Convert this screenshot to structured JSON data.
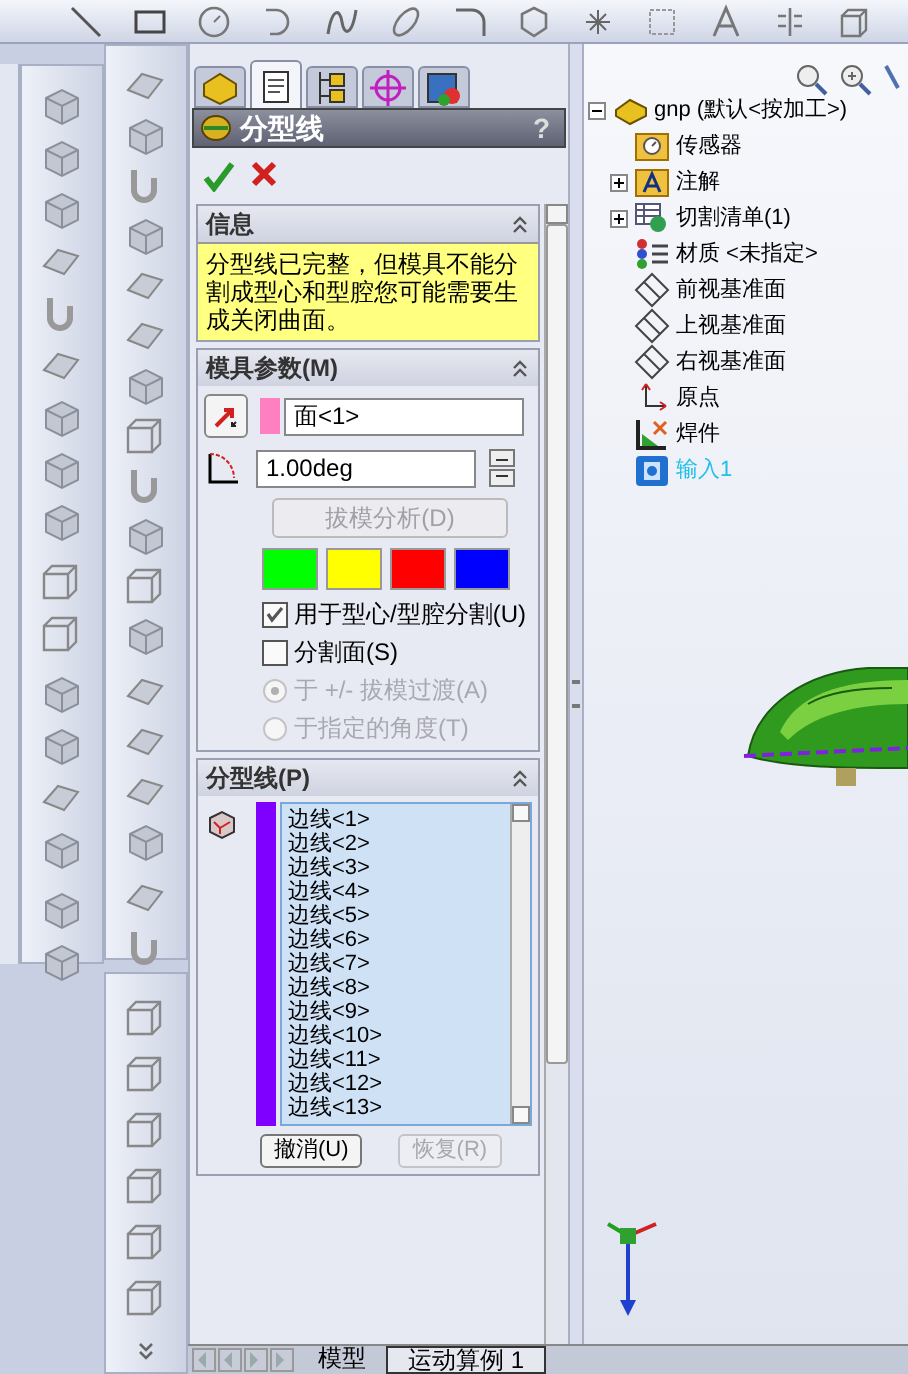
{
  "property_manager": {
    "tabs": [
      {
        "kind": "feature",
        "selected": false
      },
      {
        "kind": "property",
        "selected": true
      },
      {
        "kind": "config",
        "selected": false
      },
      {
        "kind": "target",
        "selected": false
      },
      {
        "kind": "display",
        "selected": false
      }
    ],
    "title": "分型线",
    "help": "?",
    "info": {
      "title": "信息",
      "message": "分型线已完整，但模具不能分割成型心和型腔您可能需要生成关闭曲面。"
    },
    "mold_params": {
      "title": "模具参数(M)",
      "direction_field": {
        "value": "面<1>",
        "color": "#ff80c0"
      },
      "angle_field": {
        "value": "1.00deg"
      },
      "analysis_button": {
        "label": "拔模分析(D)",
        "disabled": true
      },
      "swatches": [
        {
          "color": "#00ff00"
        },
        {
          "color": "#ffff00"
        },
        {
          "color": "#ff0000"
        },
        {
          "color": "#0000ff"
        }
      ],
      "options": [
        {
          "kind": "checkbox",
          "label": "用于型心/型腔分割(U)",
          "checked": true,
          "disabled": false
        },
        {
          "kind": "checkbox",
          "label": "分割面(S)",
          "checked": false,
          "disabled": false
        },
        {
          "kind": "radio",
          "label": "于 +/- 拔模过渡(A)",
          "selected": true,
          "disabled": true
        },
        {
          "kind": "radio",
          "label": "于指定的角度(T)",
          "selected": false,
          "disabled": true
        }
      ]
    },
    "parting_lines": {
      "title": "分型线(P)",
      "color": "#8000ff",
      "edges": [
        "边线<1>",
        "边线<2>",
        "边线<3>",
        "边线<4>",
        "边线<5>",
        "边线<6>",
        "边线<7>",
        "边线<8>",
        "边线<9>",
        "边线<10>",
        "边线<11>",
        "边线<12>",
        "边线<13>"
      ],
      "buttons": [
        {
          "label": "撤消(U)",
          "disabled": false
        },
        {
          "label": "恢复(R)",
          "disabled": true
        }
      ]
    }
  },
  "tree": {
    "label": "gnp (默认<按加工>)",
    "expanded": true,
    "children": [
      {
        "label": "传感器",
        "kind": "sensor",
        "collapsed": false,
        "highlighted": false
      },
      {
        "label": "注解",
        "kind": "annotation",
        "collapsed": true,
        "highlighted": false
      },
      {
        "label": "切割清单(1)",
        "kind": "cutlist",
        "collapsed": true,
        "highlighted": false
      },
      {
        "label": "材质 <未指定>",
        "kind": "material",
        "collapsed": false,
        "highlighted": false
      },
      {
        "label": "前视基准面",
        "kind": "plane",
        "collapsed": false,
        "highlighted": false
      },
      {
        "label": "上视基准面",
        "kind": "plane",
        "collapsed": false,
        "highlighted": false
      },
      {
        "label": "右视基准面",
        "kind": "plane",
        "collapsed": false,
        "highlighted": false
      },
      {
        "label": "原点",
        "kind": "origin",
        "collapsed": false,
        "highlighted": false
      },
      {
        "label": "焊件",
        "kind": "weldment",
        "collapsed": false,
        "highlighted": false
      },
      {
        "label": "输入1",
        "kind": "import",
        "collapsed": false,
        "highlighted": true
      }
    ]
  },
  "bottom_tabs": [
    {
      "label": "模型",
      "selected": false
    },
    {
      "label": "运动算例 1",
      "selected": true
    }
  ]
}
